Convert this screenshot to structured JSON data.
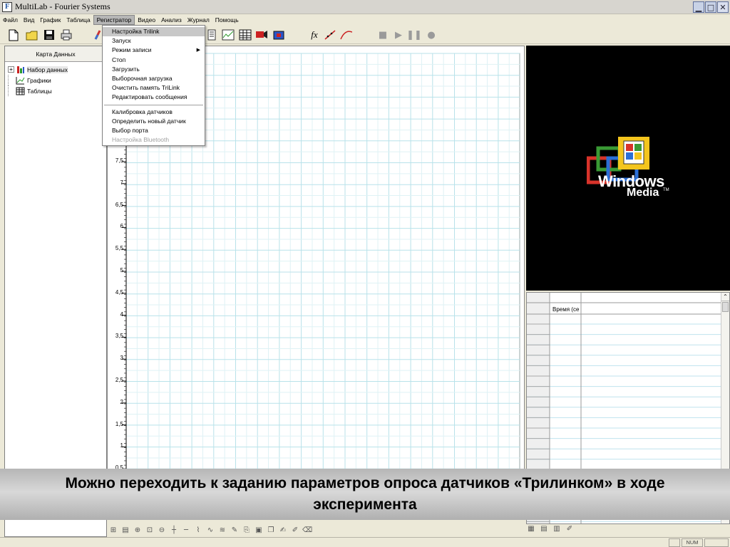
{
  "window": {
    "title": "MultiLab - Fourier Systems",
    "icon_letter": "F"
  },
  "menu": [
    "Файл",
    "Вид",
    "График",
    "Таблица",
    "Регистратор",
    "Видео",
    "Анализ",
    "Журнал",
    "Помощь"
  ],
  "dropdown": {
    "items": [
      {
        "label": "Настройка Trilink",
        "highlight": true
      },
      {
        "label": "Запуск"
      },
      {
        "label": "Режим записи",
        "submenu": true
      },
      {
        "label": "Стоп"
      },
      {
        "label": "Загрузить"
      },
      {
        "label": "Выборочная загрузка"
      },
      {
        "label": "Очистить память TriLink"
      },
      {
        "label": "Редактировать сообщения"
      }
    ],
    "items2": [
      {
        "label": "Калибровка датчиков"
      },
      {
        "label": "Определить новый датчик"
      },
      {
        "label": "Выбор порта"
      },
      {
        "label": "Настройка Bluetooth",
        "disabled": true
      }
    ]
  },
  "data_map": {
    "header": "Карта Данных",
    "items": [
      {
        "label": "Набор данных",
        "expander": "+"
      },
      {
        "label": "Графики"
      },
      {
        "label": "Таблицы"
      }
    ]
  },
  "graph": {
    "y_ticks": [
      "7,5",
      "7",
      "6,5",
      "6",
      "5,5",
      "5",
      "4,5",
      "4",
      "3,5",
      "3",
      "2,5",
      "2",
      "1,5",
      "1",
      "0,5"
    ]
  },
  "video": {
    "logo_word1": "Windows",
    "logo_word2": "Media",
    "logo_tm": "TM"
  },
  "table": {
    "column_header": "Время (се"
  },
  "caption": "Можно переходить к заданию параметров опроса датчиков «Трилинком» в ходе эксперимента",
  "status": {
    "num": "NUM"
  }
}
